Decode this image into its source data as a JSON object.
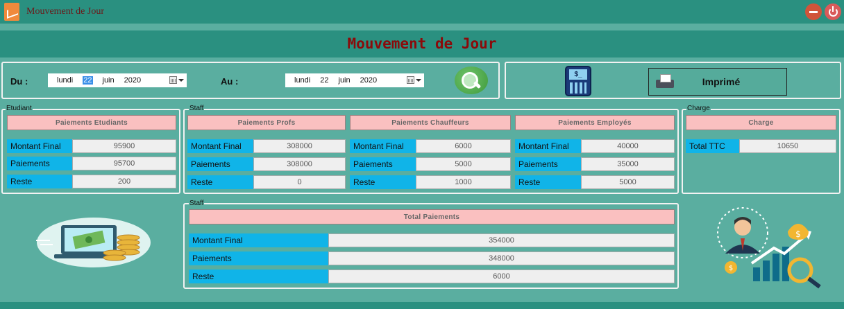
{
  "window": {
    "title": "Mouvement de Jour",
    "accent": "#2a9080",
    "background": "#5aaea0"
  },
  "header": {
    "title": "Mouvement de Jour"
  },
  "date_filter": {
    "from_label": "Du :",
    "to_label": "Au :",
    "from": {
      "weekday": "lundi",
      "day": "22",
      "month": "juin",
      "year": "2020"
    },
    "to": {
      "weekday": "lundi",
      "day": "22",
      "month": "juin",
      "year": "2020"
    },
    "search_icon": "search-icon"
  },
  "print": {
    "label": "Imprimé",
    "icon": "printer-icon",
    "calc_icon": "calculator-icon"
  },
  "etudiant": {
    "group": "Etudiant",
    "title": "Paiements Etudiants",
    "rows": [
      {
        "label": "Montant Final",
        "value": "95900"
      },
      {
        "label": "Paiements",
        "value": "95700"
      },
      {
        "label": "Reste",
        "value": "200"
      }
    ]
  },
  "staff": {
    "group": "Staff",
    "sections": [
      {
        "title": "Paiements Profs",
        "rows": [
          {
            "label": "Montant Final",
            "value": "308000"
          },
          {
            "label": "Paiements",
            "value": "308000"
          },
          {
            "label": "Reste",
            "value": "0"
          }
        ]
      },
      {
        "title": "Paiements Chauffeurs",
        "rows": [
          {
            "label": "Montant Final",
            "value": "6000"
          },
          {
            "label": "Paiements",
            "value": "5000"
          },
          {
            "label": "Reste",
            "value": "1000"
          }
        ]
      },
      {
        "title": "Paiements Employés",
        "rows": [
          {
            "label": "Montant Final",
            "value": "40000"
          },
          {
            "label": "Paiements",
            "value": "35000"
          },
          {
            "label": "Reste",
            "value": "5000"
          }
        ]
      }
    ]
  },
  "charge": {
    "group": "Charge",
    "title": "Charge",
    "rows": [
      {
        "label": "Total TTC",
        "value": "10650"
      }
    ]
  },
  "total": {
    "group": "Staff",
    "title": "Total Paiements",
    "rows": [
      {
        "label": "Montant Final",
        "value": "354000"
      },
      {
        "label": "Paiements",
        "value": "348000"
      },
      {
        "label": "Reste",
        "value": "6000"
      }
    ]
  }
}
